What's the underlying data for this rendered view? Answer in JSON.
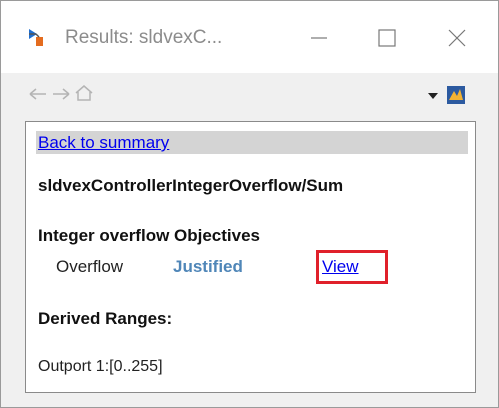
{
  "window": {
    "title": "Results: sldvexC..."
  },
  "toolbar": {
    "icons": [
      "back-arrow-icon",
      "forward-arrow-icon",
      "home-icon",
      "dropdown-arrow-icon",
      "matlab-icon"
    ]
  },
  "content": {
    "back_link": "Back to summary",
    "block_path": "sldvexControllerIntegerOverflow/Sum",
    "objectives_heading": "Integer overflow Objectives",
    "objective": {
      "name": "Overflow",
      "status": "Justified",
      "action": "View"
    },
    "derived_heading": "Derived Ranges:",
    "derived_ranges": [
      "Outport 1:[0..255]"
    ]
  },
  "colors": {
    "status_justified": "#4f86b8",
    "link": "#0000ee",
    "highlight_box": "#e0202a"
  }
}
